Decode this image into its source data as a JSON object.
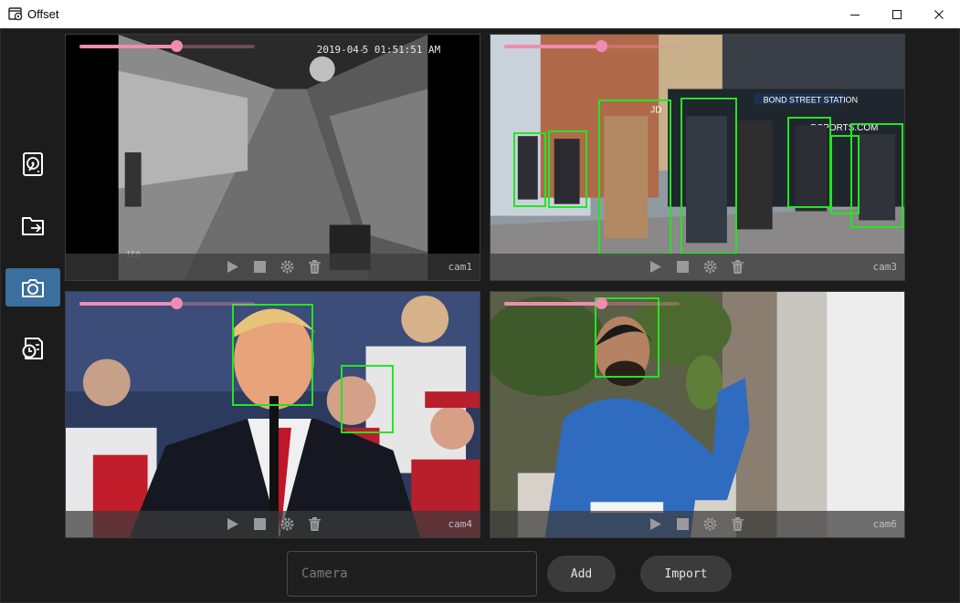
{
  "window": {
    "title": "Offset"
  },
  "sidebar": {
    "items": [
      {
        "icon": "disk-icon",
        "active": false
      },
      {
        "icon": "folder-export-icon",
        "active": false
      },
      {
        "icon": "camera-icon",
        "active": true
      },
      {
        "icon": "history-icon",
        "active": false
      }
    ]
  },
  "cameras": [
    {
      "label": "cam1",
      "timestamp": "2019-04-",
      "timestamp_time": "5 01:51:51 AM",
      "overlay_code": "IE0",
      "opacity": 0.55
    },
    {
      "label": "cam3",
      "signage": "BOND STREET STATION",
      "store_sign": "DSPORTS.COM",
      "shop_letters": "JD",
      "opacity": 0.55
    },
    {
      "label": "cam4",
      "opacity": 0.55
    },
    {
      "label": "cam6",
      "opacity": 0.55
    }
  ],
  "bottom_bar": {
    "camera_placeholder": "Camera",
    "camera_value": "",
    "add_label": "Add",
    "import_label": "Import"
  },
  "colors": {
    "accent": "#3a6f9e",
    "slider": "#f08cb0",
    "detection_box": "#22e622",
    "background": "#1c1c1c"
  }
}
